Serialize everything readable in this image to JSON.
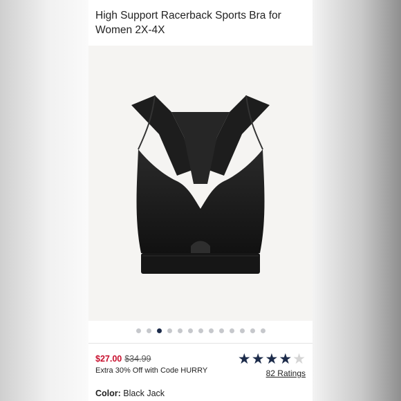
{
  "product": {
    "title": "High Support Racerback Sports Bra for Women 2X-4X"
  },
  "gallery": {
    "image_alt": "black racerback sports bra",
    "dot_count": 13,
    "active_dot": 3
  },
  "pricing": {
    "sale_price": "$27.00",
    "original_price": "$34.99",
    "promo_text": "Extra 30% Off with Code HURRY"
  },
  "rating": {
    "stars": 4,
    "max_stars": 5,
    "ratings_label": "82 Ratings"
  },
  "color": {
    "label": "Color:",
    "value": "Black Jack"
  },
  "colors": {
    "accent_navy": "#1c2b4a",
    "sale_red": "#c8102e"
  }
}
